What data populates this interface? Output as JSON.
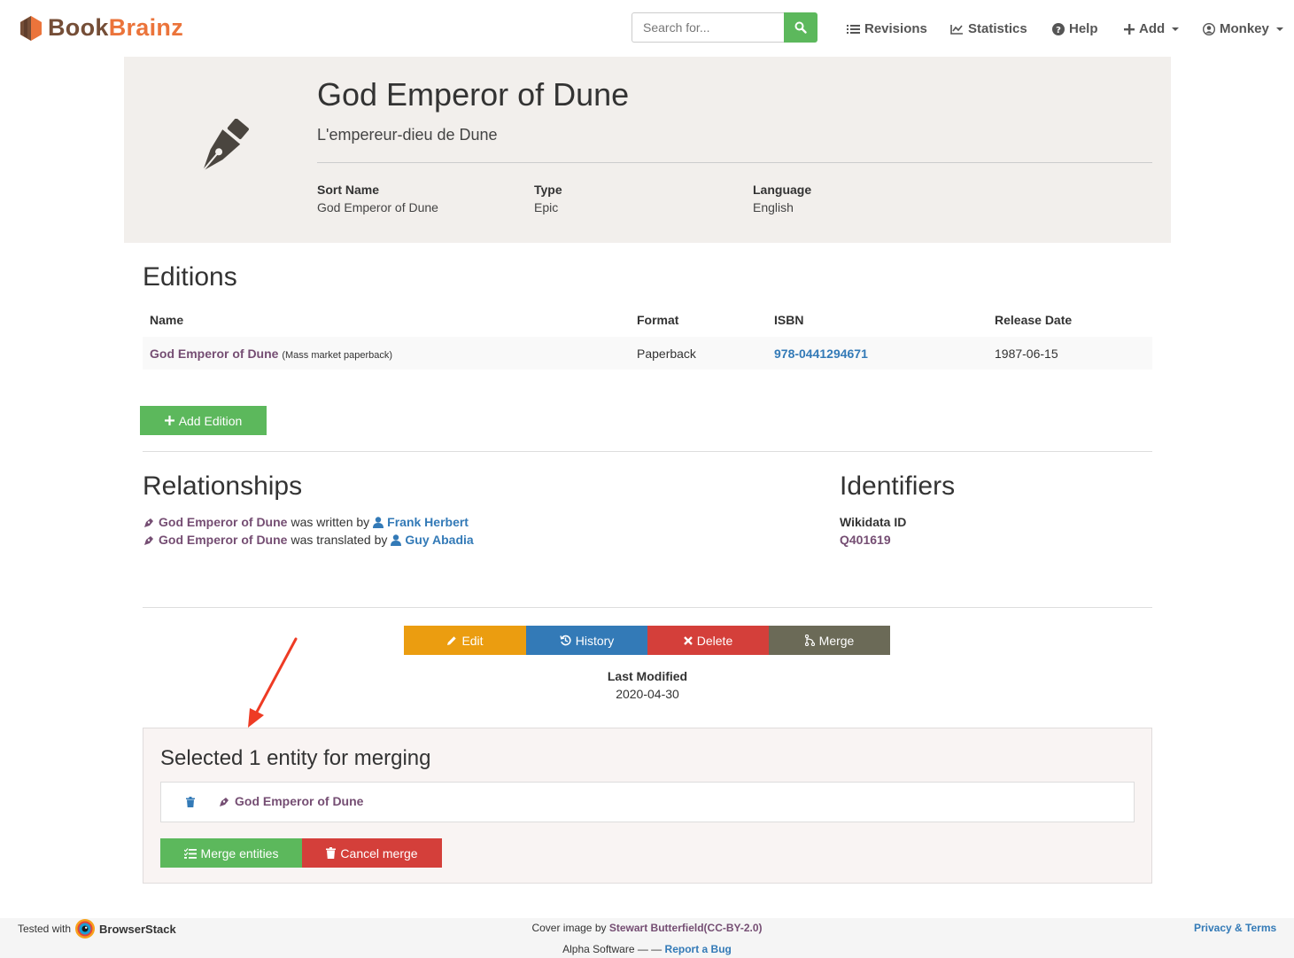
{
  "nav": {
    "brand_part1": "Book",
    "brand_part2": "Brainz",
    "search_placeholder": "Search for...",
    "items": [
      "Revisions",
      "Statistics",
      "Help",
      "Add",
      "Monkey"
    ]
  },
  "entity": {
    "title": "God Emperor of Dune",
    "subtitle": "L'empereur-dieu de Dune",
    "fields": [
      {
        "label": "Sort Name",
        "value": "God Emperor of Dune"
      },
      {
        "label": "Type",
        "value": "Epic"
      },
      {
        "label": "Language",
        "value": "English"
      }
    ]
  },
  "editions": {
    "title": "Editions",
    "columns": [
      "Name",
      "Format",
      "ISBN",
      "Release Date"
    ],
    "rows": [
      {
        "name": "God Emperor of Dune",
        "name_note": "(Mass market paperback)",
        "format": "Paperback",
        "isbn": "978-0441294671",
        "release_date": "1987-06-15"
      }
    ],
    "add_button": "Add Edition"
  },
  "relationships": {
    "title": "Relationships",
    "items": [
      {
        "source": "God Emperor of Dune",
        "verb": "was written by",
        "target": "Frank Herbert"
      },
      {
        "source": "God Emperor of Dune",
        "verb": "was translated by",
        "target": "Guy Abadia"
      }
    ]
  },
  "identifiers": {
    "title": "Identifiers",
    "label": "Wikidata ID",
    "value": "Q401619"
  },
  "actions": {
    "edit": "Edit",
    "history": "History",
    "delete": "Delete",
    "merge": "Merge",
    "last_modified_label": "Last Modified",
    "last_modified_value": "2020-04-30"
  },
  "merge_panel": {
    "title": "Selected 1 entity for merging",
    "entity": "God Emperor of Dune",
    "merge_button": "Merge entities",
    "cancel_button": "Cancel merge"
  },
  "footer": {
    "tested_with": "Tested with",
    "browserstack": "BrowserStack",
    "cover_prefix": "Cover image by",
    "cover_author": "Stewart Butterfield",
    "cover_license": "(CC-BY-2.0)",
    "alpha": "Alpha Software — —",
    "report_bug": "Report a Bug",
    "privacy": "Privacy & Terms"
  },
  "colors": {
    "accent_green": "#5cb85c",
    "link_purple": "#754e73",
    "link_blue": "#337ab7",
    "edit_orange": "#eb9d10",
    "delete_red": "#d43f3a",
    "merge_olive": "#6b6a57",
    "annotation_arrow": "#ee3b24"
  }
}
